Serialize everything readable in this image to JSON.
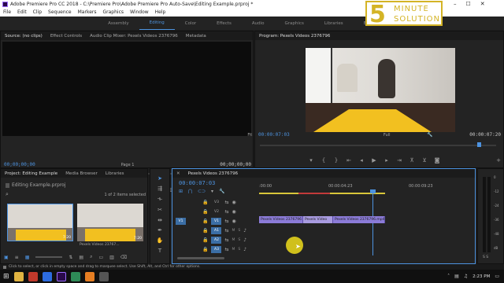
{
  "app": {
    "title": "Adobe Premiere Pro CC 2018 - C:\\Premiere Pro\\Adobe Premiere Pro Auto-Save\\Editing Example.prproj *"
  },
  "menu": [
    "File",
    "Edit",
    "Clip",
    "Sequence",
    "Markers",
    "Graphics",
    "Window",
    "Help"
  ],
  "workspaces": [
    "Assembly",
    "Editing",
    "Color",
    "Effects",
    "Audio",
    "Graphics",
    "Libraries",
    "Editing (CS5.5)"
  ],
  "logo": {
    "text_top": "MINUTE",
    "text_bottom": "SOLUTION",
    "digit": "5"
  },
  "source": {
    "tabs": [
      "Source: (no clips)",
      "Effect Controls",
      "Audio Clip Mixer: Pexels Videos 2376796",
      "Metadata"
    ],
    "tc_left": "00;00;00;00",
    "page": "Page 1",
    "tc_right": "00;00;00;00"
  },
  "program": {
    "tab": "Program: Pexels Videos 2376796",
    "tc_left": "00:00:07:03",
    "fit": "Fit",
    "quality": "Full",
    "tc_right": "00:00:07:20"
  },
  "project": {
    "tabs": [
      "Project: Editing Example",
      "Media Browser",
      "Libraries"
    ],
    "file": "Editing Example.prproj",
    "selection": "1 of 2 items selected",
    "thumb1_dur": "7:20",
    "thumb2_name": "Pexels Videos 23767...",
    "thumb2_dur": "7:20"
  },
  "timeline": {
    "tab": "Pexels Videos 2376796",
    "tc": "00:00:07:03",
    "ruler": [
      ":00:00",
      "00:00:04:23",
      "00:00:09:23"
    ],
    "tracks_video": [
      "V3",
      "V2",
      "V1"
    ],
    "tracks_audio": [
      "A1",
      "A2",
      "A3"
    ],
    "source_patch": "V1",
    "clips": [
      "Pexels Videos 2376796",
      "Pexels Video",
      "Pexels Videos 2376796.mp4"
    ]
  },
  "meter": {
    "labels": [
      "0",
      "-12",
      "-24",
      "-36",
      "-48",
      "dB"
    ],
    "bottom": "S S"
  },
  "status": {
    "text": "Click to select, or click in empty space and drag to marquee select. Use Shift, Alt, and Ctrl for other options."
  },
  "taskbar": {
    "time": "2:23 PM"
  },
  "colors": {
    "accent": "#4d93e0",
    "clip": "#8b7bd8",
    "logo": "#d4b426"
  }
}
